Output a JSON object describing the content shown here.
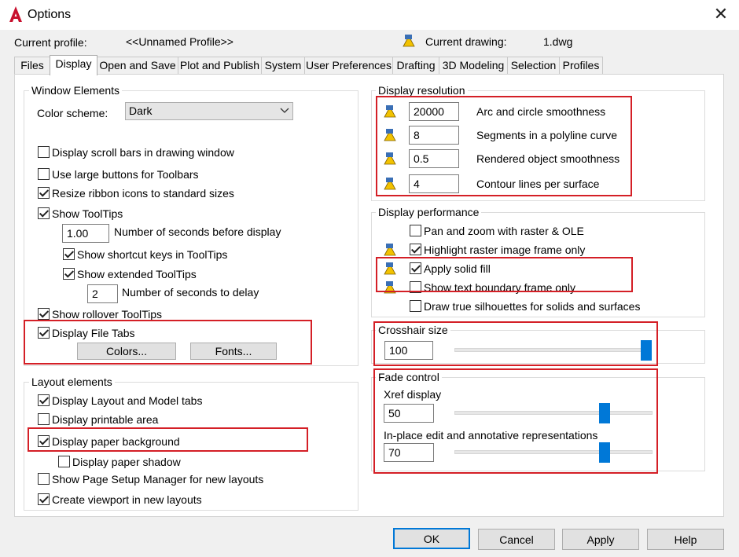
{
  "window": {
    "title": "Options"
  },
  "header": {
    "current_profile_label": "Current profile:",
    "current_profile_value": "<<Unnamed Profile>>",
    "current_drawing_label": "Current drawing:",
    "current_drawing_value": "1.dwg"
  },
  "tabs": [
    "Files",
    "Display",
    "Open and Save",
    "Plot and Publish",
    "System",
    "User Preferences",
    "Drafting",
    "3D Modeling",
    "Selection",
    "Profiles"
  ],
  "active_tab": "Display",
  "window_elements": {
    "title": "Window Elements",
    "color_scheme_label": "Color scheme:",
    "color_scheme_value": "Dark",
    "scroll_bars": "Display scroll bars in drawing window",
    "large_buttons": "Use large buttons for Toolbars",
    "resize_ribbon": "Resize ribbon icons to standard sizes",
    "show_tooltips": "Show ToolTips",
    "seconds_before_value": "1.00",
    "seconds_before_label": "Number of seconds before display",
    "shortcut_keys": "Show shortcut keys in ToolTips",
    "extended_tooltips": "Show extended ToolTips",
    "seconds_delay_value": "2",
    "seconds_delay_label": "Number of seconds to delay",
    "rollover_tooltips": "Show rollover ToolTips",
    "file_tabs": "Display File Tabs",
    "colors_button": "Colors...",
    "fonts_button": "Fonts..."
  },
  "layout_elements": {
    "title": "Layout elements",
    "layout_model_tabs": "Display Layout and Model tabs",
    "printable_area": "Display printable area",
    "paper_background": "Display paper background",
    "paper_shadow": "Display paper shadow",
    "page_setup_manager": "Show Page Setup Manager for new layouts",
    "create_viewport": "Create viewport in new layouts"
  },
  "display_resolution": {
    "title": "Display resolution",
    "arc_value": "20000",
    "arc_label": "Arc and circle smoothness",
    "segments_value": "8",
    "segments_label": "Segments in a polyline curve",
    "rendered_value": "0.5",
    "rendered_label": "Rendered object smoothness",
    "contour_value": "4",
    "contour_label": "Contour lines per surface"
  },
  "display_performance": {
    "title": "Display performance",
    "pan_zoom": "Pan and zoom with raster & OLE",
    "highlight_raster": "Highlight raster image frame only",
    "apply_solid_fill": "Apply solid fill",
    "text_boundary": "Show text boundary frame only",
    "true_silhouettes": "Draw true silhouettes for solids and surfaces"
  },
  "crosshair": {
    "title": "Crosshair size",
    "value": "100",
    "slider_fraction": 1.0
  },
  "fade_control": {
    "title": "Fade control",
    "xref_label": "Xref display",
    "xref_value": "50",
    "xref_fraction": 0.75,
    "inplace_label": "In-place edit and annotative representations",
    "inplace_value": "70",
    "inplace_fraction": 0.75
  },
  "footer": {
    "ok": "OK",
    "cancel": "Cancel",
    "apply": "Apply",
    "help": "Help"
  },
  "colors": {
    "highlight_red": "#d41f26",
    "accent_blue": "#0078d7",
    "logo_red": "#c8102e"
  },
  "icons": [
    "autocad-logo-icon",
    "drawing-setting-icon",
    "close-icon",
    "chevron-down-icon"
  ]
}
